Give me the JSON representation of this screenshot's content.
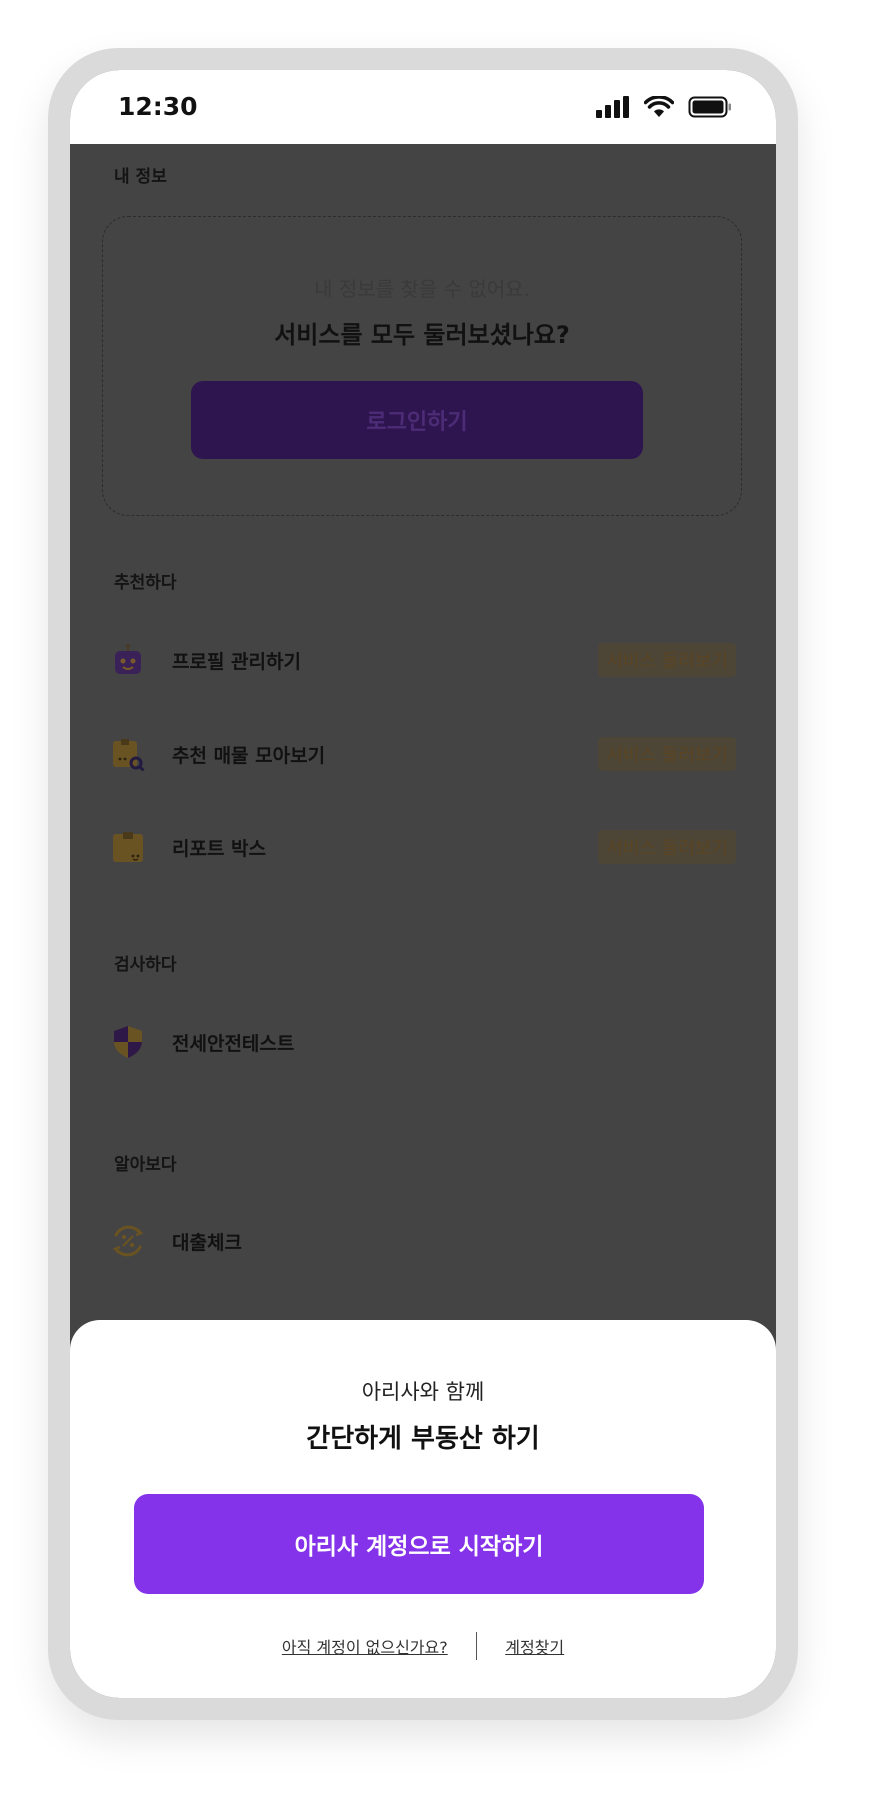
{
  "status_bar": {
    "time": "12:30",
    "icons": [
      "cellular-signal-icon",
      "wifi-icon",
      "battery-icon"
    ]
  },
  "my_info": {
    "section_title": "내 정보",
    "empty_message": "내 정보를 찾을 수 없어요.",
    "prompt": "서비스를 모두 둘러보셨나요?",
    "login_button": "로그인하기"
  },
  "recommend": {
    "section_title": "추천하다",
    "items": [
      {
        "label": "프로필 관리하기",
        "tag": "서비스 둘러보기",
        "icon": "profile-robot-icon"
      },
      {
        "label": "추천 매물 모아보기",
        "tag": "서비스 둘러보기",
        "icon": "box-search-icon"
      },
      {
        "label": "리포트 박스",
        "tag": "서비스 둘러보기",
        "icon": "report-box-icon"
      }
    ]
  },
  "inspect": {
    "section_title": "검사하다",
    "items": [
      {
        "label": "전세안전테스트",
        "icon": "shield-icon"
      }
    ]
  },
  "explore": {
    "section_title": "알아보다",
    "items": [
      {
        "label": "대출체크",
        "icon": "percent-circle-icon"
      }
    ]
  },
  "sheet": {
    "subtitle": "아리사와 함께",
    "title": "간단하게 부동산 하기",
    "start_button": "아리사 계정으로 시작하기",
    "signup_link": "아직 계정이 없으신가요?",
    "find_account_link": "계정찾기"
  },
  "colors": {
    "accent": "#8533ea",
    "overlay": "#444444",
    "tag_text": "#5a4422"
  }
}
